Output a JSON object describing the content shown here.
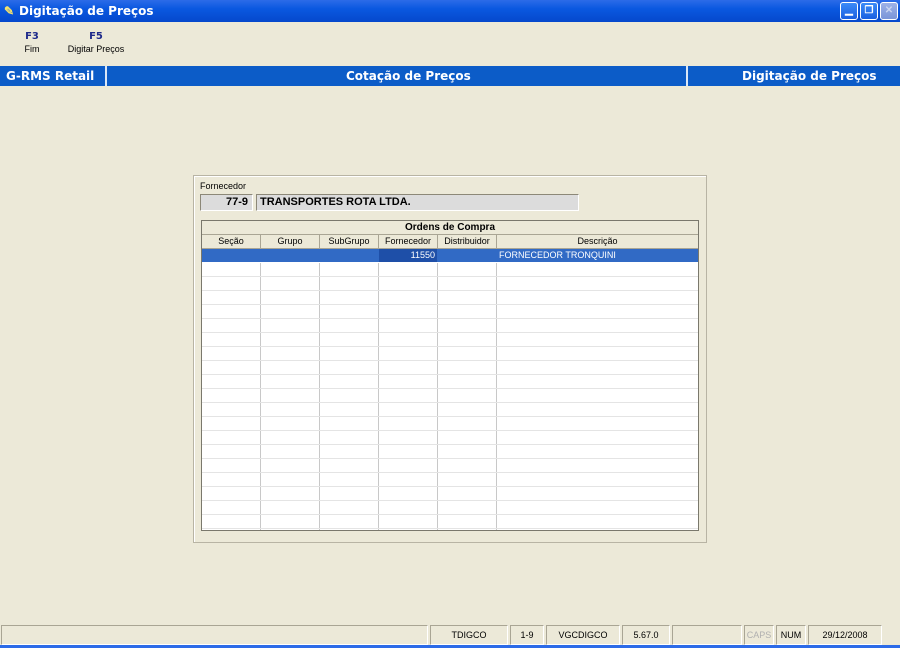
{
  "window": {
    "title": "Digitação de Preços"
  },
  "function_keys": [
    {
      "key": "F3",
      "label": "Fim"
    },
    {
      "key": "F5",
      "label": "Digitar Preços"
    }
  ],
  "module_bar": {
    "left": "G-RMS Retail",
    "center": "Cotação de Preços",
    "right": "Digitação de Preços"
  },
  "fornecedor": {
    "label": "Fornecedor",
    "code": "77-9",
    "name": "TRANSPORTES ROTA LTDA."
  },
  "grid": {
    "caption": "Ordens de Compra",
    "columns": [
      "Seção",
      "Grupo",
      "SubGrupo",
      "Fornecedor",
      "Distribuidor",
      "Descrição"
    ],
    "rows": [
      {
        "secao": "",
        "grupo": "",
        "subgrupo": "",
        "fornecedor": "11550",
        "distribuidor": "",
        "descricao": "FORNECEDOR TRONQUINI",
        "selected": true
      }
    ]
  },
  "status_bar": {
    "program": "TDIGCO",
    "page": "1-9",
    "module": "VGCDIGCO",
    "version": "5.67.0",
    "caps": "CAPS",
    "num": "NUM",
    "date": "29/12/2008"
  },
  "colors": {
    "title_bar": "#0A58E0",
    "module_bar": "#0C5CC8",
    "selection": "#316AC5",
    "background": "#ECE9D8"
  }
}
